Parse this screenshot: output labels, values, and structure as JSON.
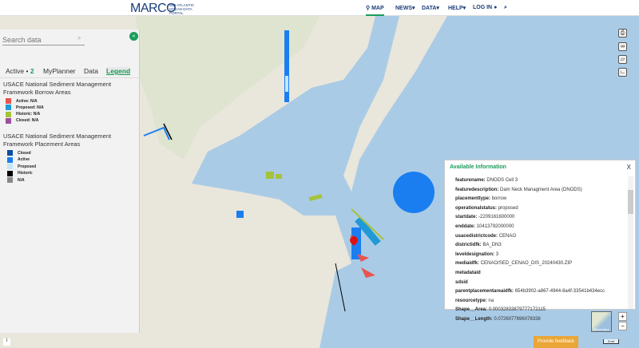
{
  "header": {
    "logo": "MARCO",
    "logo_sub": "MID-ATLANTIC OCEAN DATA PORTAL",
    "nav": [
      "MAP",
      "NEWS▾",
      "DATA▾",
      "HELP▾",
      "LOG IN"
    ],
    "icons": [
      "map-pin-icon",
      "user-icon",
      "search-icon"
    ]
  },
  "panel": {
    "search_placeholder": "Search data",
    "tabs": {
      "active": "Active •",
      "active_count": "2",
      "myplanner": "MyPlanner",
      "data": "Data",
      "legend": "Legend"
    },
    "legend": [
      {
        "title": "USACE National Sediment Management Framework Borrow Areas",
        "items": [
          {
            "label": "Active: N/A",
            "color": "#e8554e"
          },
          {
            "label": "Proposed: N/A",
            "color": "#1f9ad6"
          },
          {
            "label": "Historic: N/A",
            "color": "#a6c23a"
          },
          {
            "label": "Closed: N/A",
            "color": "#9b4fa0"
          }
        ]
      },
      {
        "title": "USACE National Sediment Management Framework Placement Areas",
        "items": [
          {
            "label": "Closed",
            "color": "#0b4ea2"
          },
          {
            "label": "Active",
            "color": "#1a7ef0"
          },
          {
            "label": "Proposed",
            "color": "#bfe6fb"
          },
          {
            "label": "Historic",
            "color": "#000000"
          },
          {
            "label": "N/A",
            "color": "#888888"
          }
        ]
      }
    ]
  },
  "popup": {
    "title": "Available Information",
    "close": "X",
    "rows": [
      {
        "k": "featurename:",
        "v": "DNODS Cell 3"
      },
      {
        "k": "featuredescription:",
        "v": "Dam Neck Managment Area (DNODS)"
      },
      {
        "k": "placementtype:",
        "v": "borrow"
      },
      {
        "k": "operationalstatus:",
        "v": "proposed"
      },
      {
        "k": "startdate:",
        "v": "-2209161600000"
      },
      {
        "k": "enddate:",
        "v": "10413792000000"
      },
      {
        "k": "usacedistrictcode:",
        "v": "CENAO"
      },
      {
        "k": "districtidfk:",
        "v": "BA_DN3"
      },
      {
        "k": "leveldesignation:",
        "v": "3"
      },
      {
        "k": "mediaidfk:",
        "v": "CENAO/SED_CENAO_DIS_20240430.ZIP"
      },
      {
        "k": "metadataid",
        "v": ""
      },
      {
        "k": "sdsid",
        "v": ""
      },
      {
        "k": "parentplacementareaidfk:",
        "v": "654b3902-a867-4944-8a4f-33541b434ecc"
      },
      {
        "k": "resourcetype:",
        "v": "na"
      },
      {
        "k": "Shape__Area:",
        "v": "0.00032833879777172115"
      },
      {
        "k": "Shape__Length:",
        "v": "0.0726077696078338"
      }
    ]
  },
  "map": {
    "tools": [
      "print-icon",
      "link-icon",
      "measure-icon",
      "ruler-icon"
    ],
    "zoom_in": "+",
    "zoom_out": "−",
    "basemap": "Basemaps",
    "feedback": "Provide feedback",
    "scale": "5 mi",
    "info": "i"
  }
}
